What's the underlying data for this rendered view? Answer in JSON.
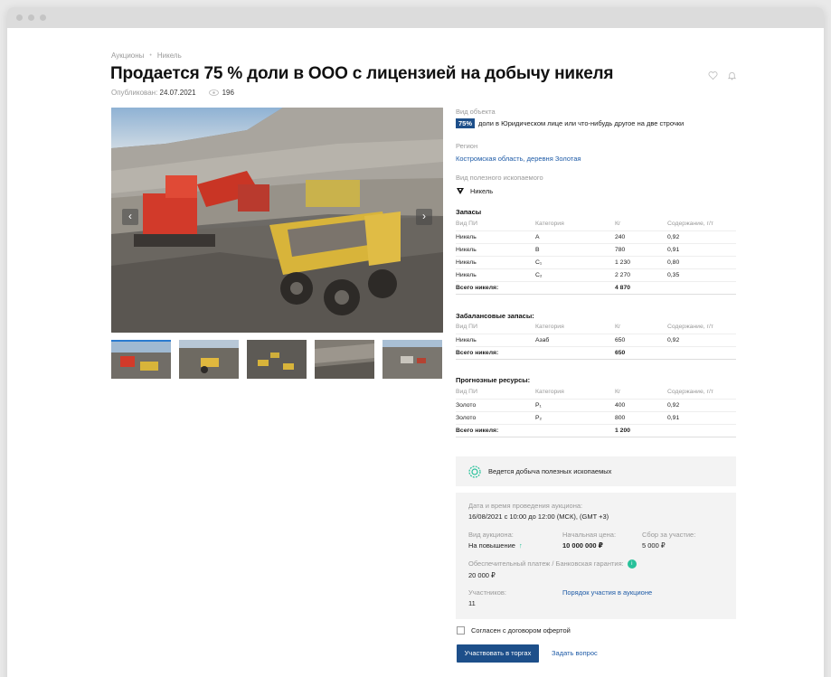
{
  "breadcrumb": [
    "Аукционы",
    "Никель"
  ],
  "title": "Продается 75 % доли в ООО с лицензией на добычу никеля",
  "meta": {
    "published_label": "Опубликован:",
    "published_date": "24.07.2021",
    "views": "196"
  },
  "icons": {
    "favorite": "heart-icon",
    "notify": "bell-icon",
    "views": "eye-icon",
    "prev": "chevron-left-icon",
    "next": "chevron-right-icon",
    "mining": "gear-icon",
    "info": "info-icon"
  },
  "gallery": {
    "prev": "‹",
    "next": "›",
    "thumb_count": 5
  },
  "object": {
    "label": "Вид объекта",
    "badge": "75%",
    "text": "доли в Юридическом лице или что-нибудь другое на две строчки"
  },
  "region": {
    "label": "Регион",
    "value": "Костромская область, деревня Золотая"
  },
  "mineral": {
    "label": "Вид полезного ископаемого",
    "value": "Никель"
  },
  "columns": [
    "Вид ПИ",
    "Категория",
    "Кг",
    "Содержание, г/т"
  ],
  "reserves": {
    "title": "Запасы",
    "rows": [
      [
        "Никель",
        "А",
        "240",
        "0,92"
      ],
      [
        "Никель",
        "В",
        "780",
        "0,91"
      ],
      [
        "Никель",
        "С₁",
        "1 230",
        "0,80"
      ],
      [
        "Никель",
        "С₂",
        "2 270",
        "0,35"
      ]
    ],
    "total_label": "Всего никеля:",
    "total": "4 870"
  },
  "offbalance": {
    "title": "Забалансовые запасы:",
    "rows": [
      [
        "Никель",
        "Азаб",
        "650",
        "0,92"
      ]
    ],
    "total_label": "Всего никеля:",
    "total": "650"
  },
  "forecast": {
    "title": "Прогнозные ресурсы:",
    "rows": [
      [
        "Золото",
        "P₁",
        "400",
        "0,92"
      ],
      [
        "Золото",
        "P₂",
        "800",
        "0,91"
      ]
    ],
    "total_label": "Всего никеля:",
    "total": "1 200"
  },
  "mining_status": "Ведется добыча полезных ископаемых",
  "auction": {
    "date_label": "Дата и время проведения аукциона:",
    "date_value": "16/08/2021 с 10:00 до 12:00 (МСК), (GMT +3)",
    "type_label": "Вид аукциона:",
    "type_value": "На повышение",
    "price_label": "Начальная цена:",
    "price_value": "10 000 000 ₽",
    "fee_label": "Сбор за участие:",
    "fee_value": "5 000 ₽",
    "guarantee_label": "Обеспечительный платеж / Банковская гарантия:",
    "guarantee_value": "20 000 ₽",
    "participants_label": "Участников:",
    "participants_value": "11",
    "order_link": "Порядок участия в аукционе"
  },
  "agree_label": "Согласен с договором офертой",
  "buttons": {
    "participate": "Участвовать в торгах",
    "ask": "Задать вопрос"
  },
  "colors": {
    "primary": "#1d4f8a",
    "link": "#1d5aa6",
    "accent": "#27c19a"
  }
}
